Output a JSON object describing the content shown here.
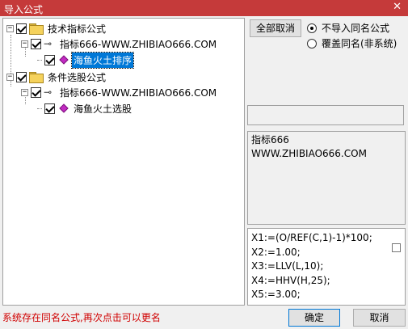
{
  "window": {
    "title": "导入公式",
    "close": "✕"
  },
  "tree": {
    "nodes": [
      {
        "label": "技术指标公式"
      },
      {
        "label": "指标666-WWW.ZHIBIAO666.COM"
      },
      {
        "label": "海鱼火土排序"
      },
      {
        "label": "条件选股公式"
      },
      {
        "label": "指标666-WWW.ZHIBIAO666.COM"
      },
      {
        "label": "海鱼火土选股"
      }
    ]
  },
  "options": {
    "select_all_label": "全部取消",
    "radio_skip": "不导入同名公式",
    "radio_overwrite": "覆盖同名(非系统)"
  },
  "description": {
    "line1": "指标666",
    "line2": "WWW.ZHIBIAO666.COM"
  },
  "formula": {
    "lines": [
      "X1:=(O/REF(C,1)-1)*100;",
      "X2:=1.00;",
      "X3:=LLV(L,10);",
      "X4:=HHV(H,25);",
      "X5:=3.00;"
    ]
  },
  "status": {
    "message": "系统存在同名公式,再次点击可以更名"
  },
  "footer": {
    "ok_label": "确定",
    "cancel_label": "取消"
  }
}
